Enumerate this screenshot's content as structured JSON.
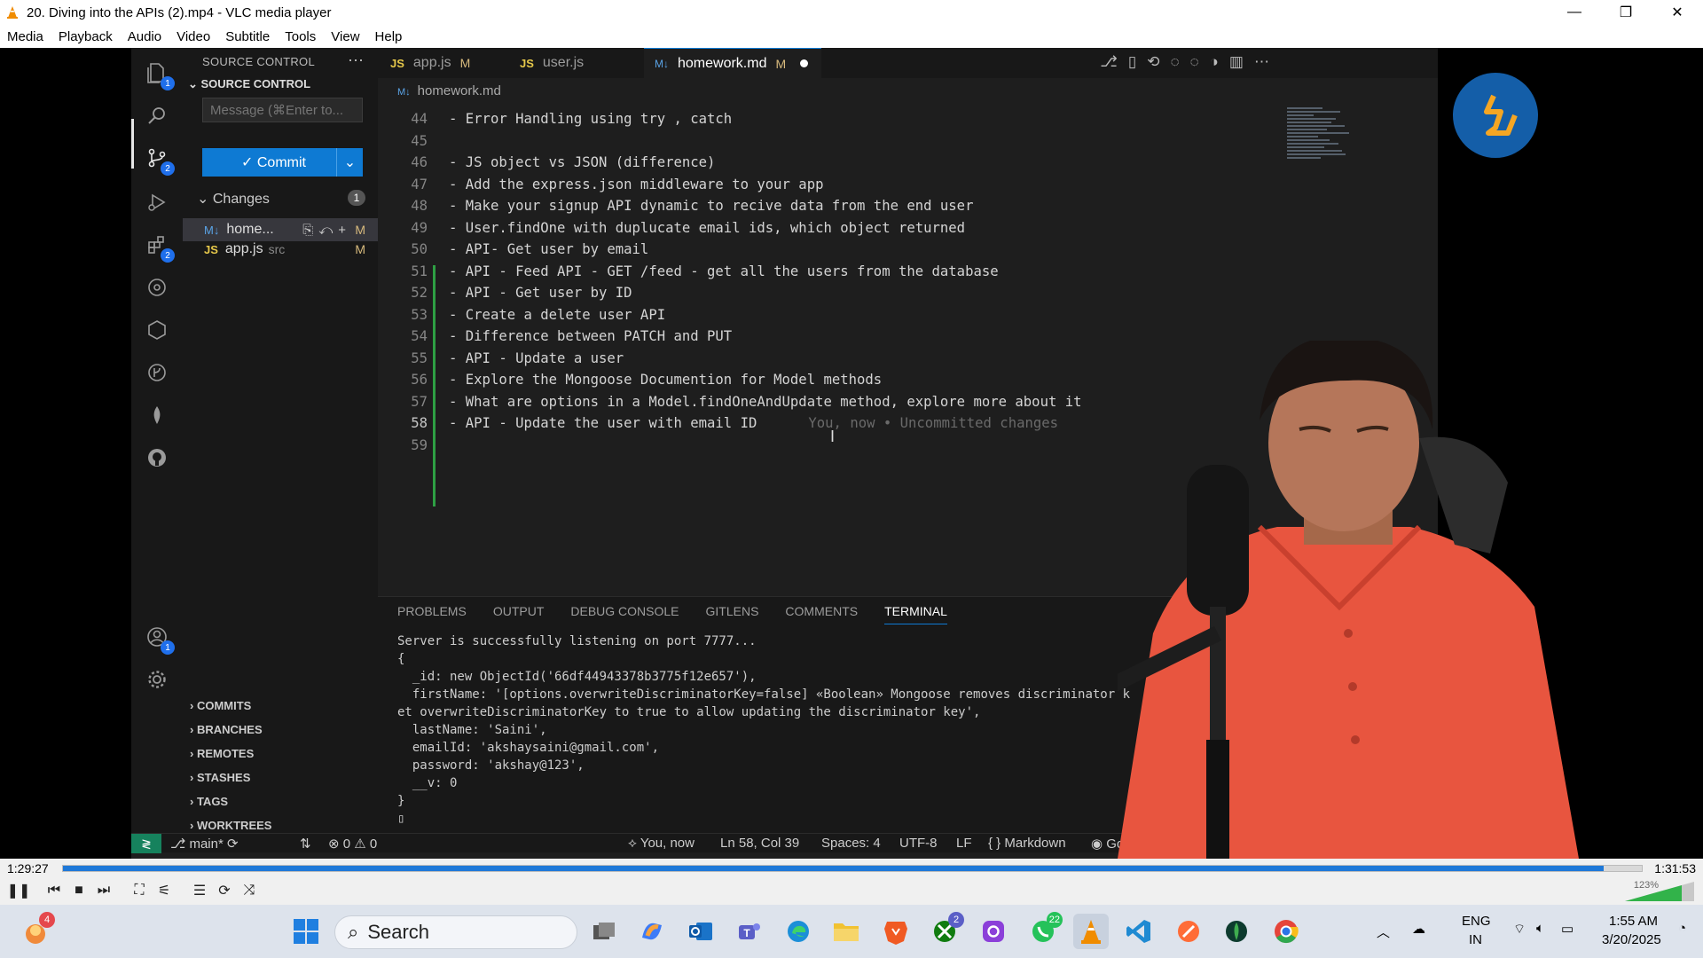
{
  "window": {
    "title": "20. Diving into the APIs (2).mp4 - VLC media player",
    "minimize": "—",
    "maximize": "❐",
    "close": "✕"
  },
  "menu": [
    "Media",
    "Playback",
    "Audio",
    "Video",
    "Subtitle",
    "Tools",
    "View",
    "Help"
  ],
  "activity_badges": {
    "explorer": "1",
    "scm": "2",
    "extensions": "2",
    "accounts": "1"
  },
  "sidebar": {
    "header": "SOURCE CONTROL",
    "section": "SOURCE CONTROL",
    "message_placeholder": "Message (⌘Enter to...",
    "commit_label": "✓ Commit",
    "changes_label": "Changes",
    "changes_count": "1",
    "files": [
      {
        "icon": "M↓",
        "name": "home...",
        "dir": "",
        "status": "M"
      },
      {
        "icon": "JS",
        "name": "app.js",
        "dir": "src",
        "status": "M"
      }
    ],
    "tree": [
      "COMMITS",
      "BRANCHES",
      "REMOTES",
      "STASHES",
      "TAGS",
      "WORKTREES"
    ]
  },
  "tabs": [
    {
      "icon": "JS",
      "name": "app.js",
      "status": "M"
    },
    {
      "icon": "JS",
      "name": "user.js",
      "status": ""
    },
    {
      "icon": "M↓",
      "name": "homework.md",
      "status": "M"
    }
  ],
  "breadcrumb": "homework.md",
  "code_lines": [
    {
      "n": "44",
      "t": "- Error Handling using try , catch"
    },
    {
      "n": "45",
      "t": ""
    },
    {
      "n": "46",
      "t": "- JS object vs JSON (difference)"
    },
    {
      "n": "47",
      "t": "- Add the express.json middleware to your app"
    },
    {
      "n": "48",
      "t": "- Make your signup API dynamic to recive data from the end user"
    },
    {
      "n": "49",
      "t": "- User.findOne with duplucate email ids, which object returned"
    },
    {
      "n": "50",
      "t": "- API- Get user by email"
    },
    {
      "n": "51",
      "t": "- API - Feed API - GET /feed - get all the users from the database"
    },
    {
      "n": "52",
      "t": "- API - Get user by ID"
    },
    {
      "n": "53",
      "t": "- Create a delete user API"
    },
    {
      "n": "54",
      "t": "- Difference between PATCH and PUT"
    },
    {
      "n": "55",
      "t": "- API - Update a user"
    },
    {
      "n": "56",
      "t": "- Explore the Mongoose Documention for Model methods"
    },
    {
      "n": "57",
      "t": "- What are options in a Model.findOneAndUpdate method, explore more about it"
    },
    {
      "n": "58",
      "t": "- API - Update the user with email ID"
    },
    {
      "n": "59",
      "t": ""
    }
  ],
  "blame": "You, now • Uncommitted changes",
  "panel_tabs": [
    "PROBLEMS",
    "OUTPUT",
    "DEBUG CONSOLE",
    "GITLENS",
    "COMMENTS",
    "TERMINAL"
  ],
  "terminal": [
    "Server is successfully listening on port 7777...",
    "{",
    "  _id: new ObjectId('66df44943378b3775f12e657'),",
    "  firstName: '[options.overwriteDiscriminatorKey=false] «Boolean» Mongoose removes discriminator k",
    "et overwriteDiscriminatorKey to true to allow updating the discriminator key',",
    "  lastName: 'Saini',",
    "  emailId: 'akshaysaini@gmail.com',",
    "  password: 'akshay@123',",
    "  __v: 0",
    "}"
  ],
  "status": {
    "branch": "main*",
    "problems": "⊗ 0 ⚠ 0",
    "blame": "You, now",
    "position": "Ln 58, Col 39",
    "spaces": "Spaces: 4",
    "encoding": "UTF-8",
    "eol": "LF",
    "language": "Markdown",
    "golive": "Go Live"
  },
  "player": {
    "elapsed": "1:29:27",
    "total": "1:31:53",
    "progress": 0.976,
    "volume": "123%"
  },
  "taskbar": {
    "search_label": "Search",
    "badge_left": "4",
    "badge_teams": "2",
    "badge_whatsapp": "22",
    "lang": "ENG",
    "region": "IN",
    "time": "1:55 AM",
    "date": "3/20/2025"
  }
}
